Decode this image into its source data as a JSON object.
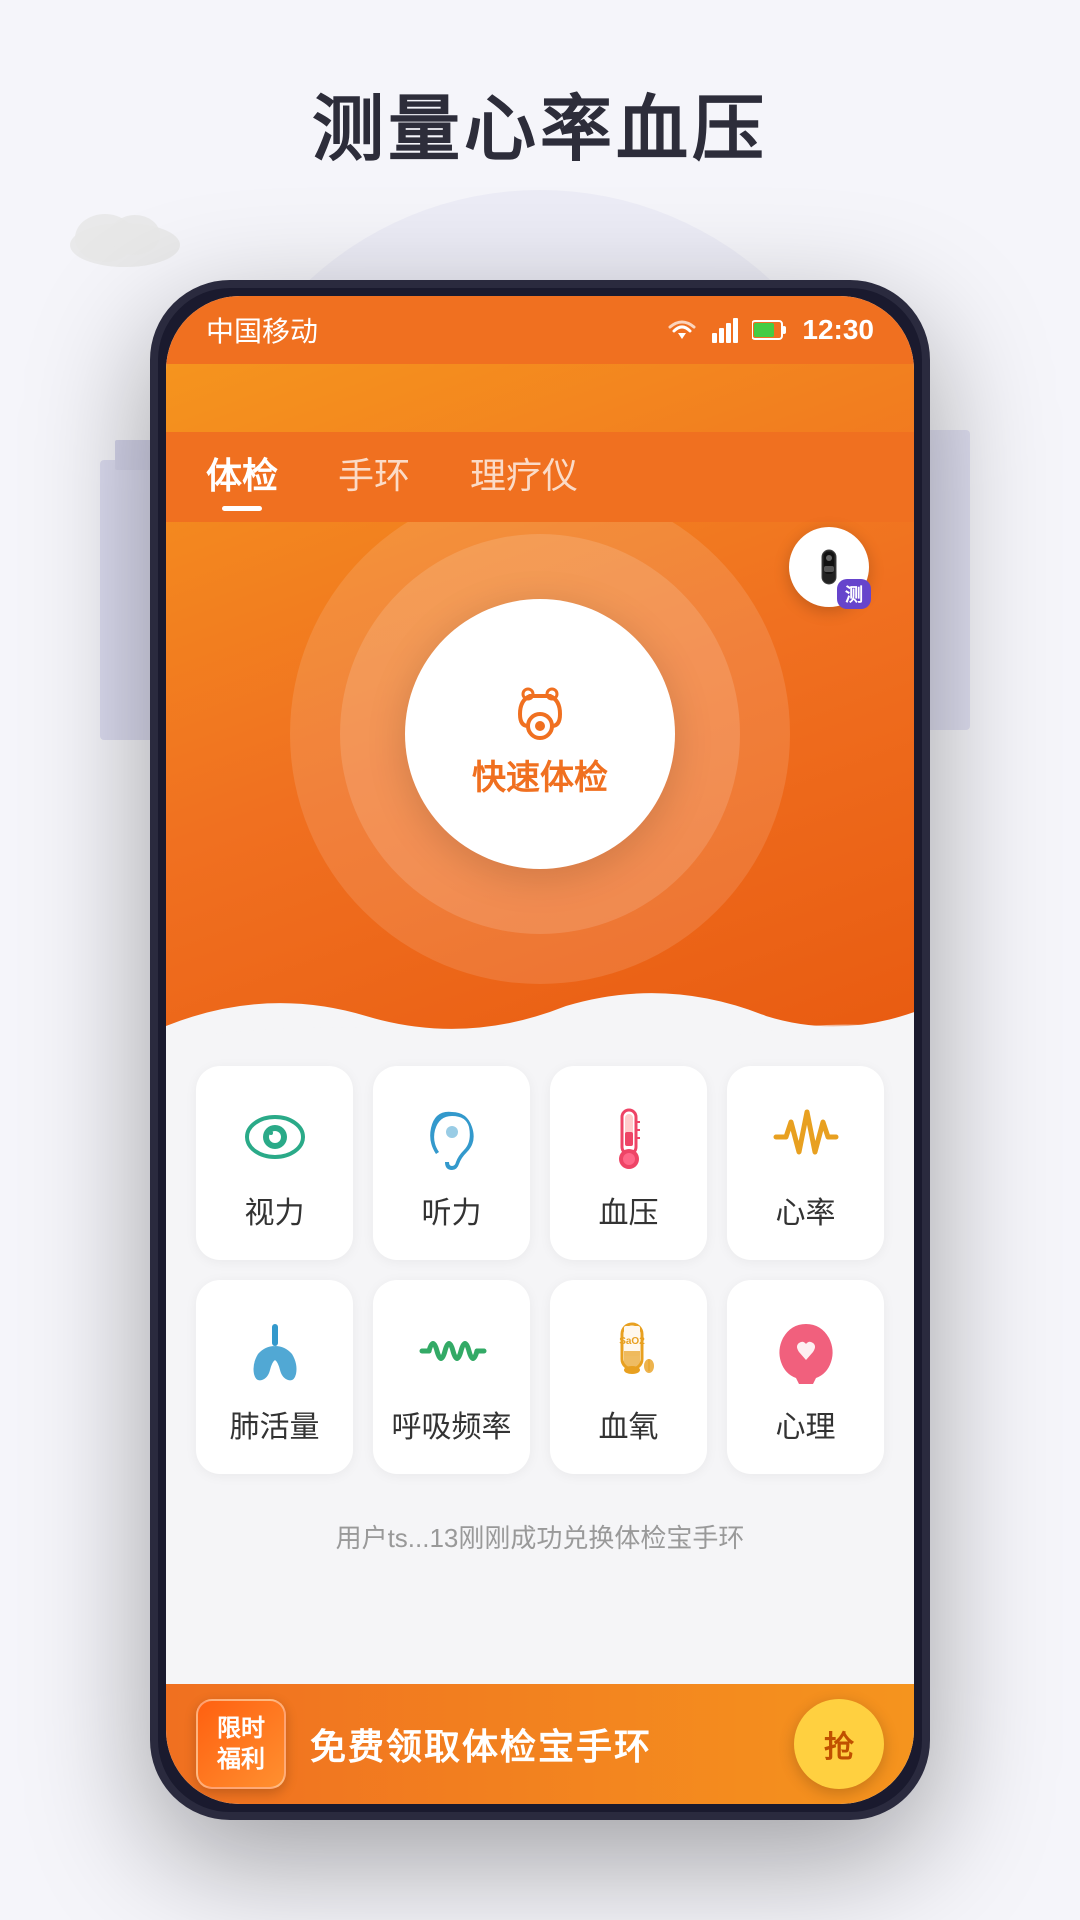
{
  "page": {
    "title": "测量心率血压",
    "background_color": "#f5f5fa"
  },
  "status_bar": {
    "carrier": "中国移动",
    "time": "12:30",
    "wifi": "▼",
    "signal": "▲",
    "battery": "🔋"
  },
  "tabs": [
    {
      "id": "tijian",
      "label": "体检",
      "active": true
    },
    {
      "id": "shouhuan",
      "label": "手环",
      "active": false
    },
    {
      "id": "liaoyi",
      "label": "理疗仪",
      "active": false
    }
  ],
  "hero": {
    "center_icon": "🩺",
    "center_label": "快速体检"
  },
  "device_badge": {
    "icon": "⌚",
    "label": "测"
  },
  "grid_rows": [
    [
      {
        "id": "vision",
        "icon_color": "#2aaa88",
        "label": "视力",
        "icon_type": "eye"
      },
      {
        "id": "hearing",
        "icon_color": "#3399cc",
        "label": "听力",
        "icon_type": "ear"
      },
      {
        "id": "blood_pressure",
        "icon_color": "#ee4466",
        "label": "血压",
        "icon_type": "thermometer"
      },
      {
        "id": "heart_rate",
        "icon_color": "#e8a020",
        "label": "心率",
        "icon_type": "heartbeat"
      }
    ],
    [
      {
        "id": "lung",
        "icon_color": "#3399cc",
        "label": "肺活量",
        "icon_type": "lung"
      },
      {
        "id": "breathing",
        "icon_color": "#33aa66",
        "label": "呼吸频率",
        "icon_type": "wave"
      },
      {
        "id": "blood_oxygen",
        "icon_color": "#e8a020",
        "label": "血氧",
        "icon_type": "tube"
      },
      {
        "id": "psychology",
        "icon_color": "#ee4466",
        "label": "心理",
        "icon_type": "head"
      }
    ]
  ],
  "ticker": {
    "text": "用户ts...13刚刚成功兑换体检宝手环"
  },
  "banner": {
    "badge_line1": "限时",
    "badge_line2": "福利",
    "main_text": "免费领取体检宝手环",
    "button_label": "抢"
  }
}
